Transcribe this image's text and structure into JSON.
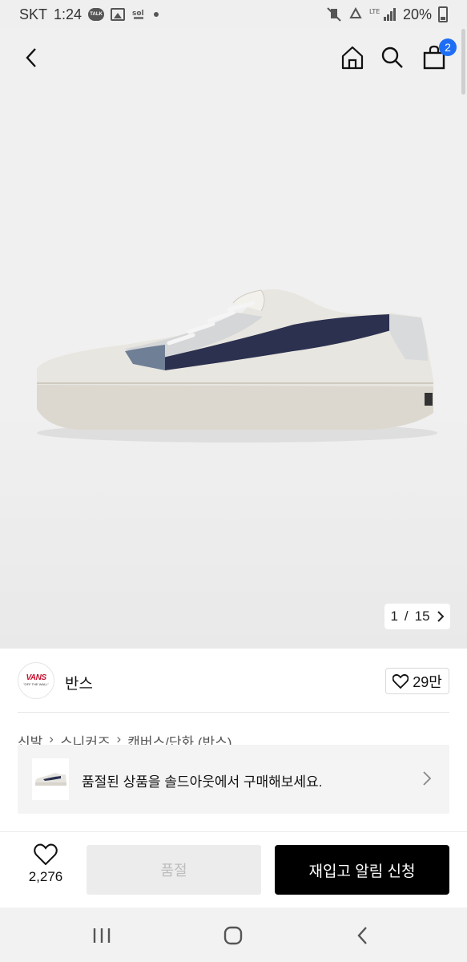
{
  "status_bar": {
    "carrier": "SKT",
    "time": "1:24",
    "talk_badge": "TALK",
    "network": "LTE",
    "battery": "20%"
  },
  "header": {
    "cart_count": "2"
  },
  "gallery": {
    "current": "1",
    "separator": "/",
    "total": "15"
  },
  "brand": {
    "logo_text": "VANS",
    "logo_tagline": "\"OFF THE WALL\"",
    "name": "반스",
    "likes": "29만"
  },
  "breadcrumb": [
    "신발",
    "스니커즈",
    "캔버스/단화 (반스)"
  ],
  "soldout_banner": {
    "text": "품절된 상품을 솔드아웃에서 구매해보세요."
  },
  "bottom_bar": {
    "wish_count": "2,276",
    "soldout_label": "품절",
    "restock_label": "재입고 알림 신청"
  },
  "colors": {
    "accent_blue": "#1e6ef5",
    "brand_red": "#c8102e",
    "primary_button": "#000000",
    "disabled_button": "#ececec"
  }
}
